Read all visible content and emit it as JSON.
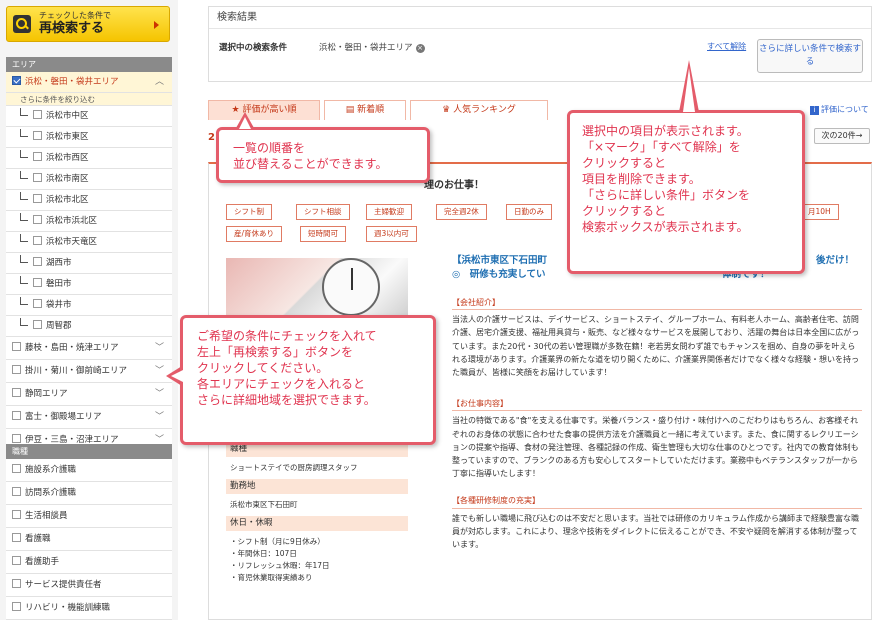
{
  "research_button": {
    "small": "チェックした条件で",
    "big": "再検索する"
  },
  "sidebar": {
    "area_header": "エリア",
    "selected_area": "浜松・磐田・袋井エリア",
    "narrow_hint": "さらに条件を絞り込む",
    "sub_areas": [
      "浜松市中区",
      "浜松市東区",
      "浜松市西区",
      "浜松市南区",
      "浜松市北区",
      "浜松市浜北区",
      "浜松市天竜区",
      "湖西市",
      "磐田市",
      "袋井市",
      "周智郡"
    ],
    "other_areas": [
      "藤枝・島田・焼津エリア",
      "掛川・菊川・御前崎エリア",
      "静岡エリア",
      "富士・御殿場エリア",
      "伊豆・三島・沼津エリア"
    ],
    "job_header": "職種",
    "jobs": [
      "施設系介護職",
      "訪問系介護職",
      "生活相談員",
      "看護職",
      "看護助手",
      "サービス提供責任者",
      "リハビリ・機能訓練職"
    ]
  },
  "results": {
    "header": "検索結果",
    "condition_label": "選択中の検索条件",
    "condition_value": "浜松・磐田・袋井エリア",
    "clear_all": "すべて解除",
    "more_conditions": "さらに詳しい条件で検索する"
  },
  "tabs": [
    "評価が高い順",
    "新着順",
    "人気ランキング"
  ],
  "rating_link": "評価について",
  "count_prefix": "2",
  "next_button": "次の20件→",
  "card": {
    "title_fragment": "理のお仕事！",
    "tags": [
      "シフト制",
      "シフト相談",
      "主婦歓迎",
      "完全週2休",
      "日勤のみ",
      "月10H",
      "産/育休あり",
      "短時間可",
      "週3以内可"
    ],
    "head_lines": [
      "【浜松市東区下石田町",
      "後だけ！",
      "◎　研修も充実してい",
      "体制です！"
    ],
    "sections": [
      {
        "title": "【会社紹介】",
        "body": "当法人の介護サービスは、デイサービス、ショートステイ、グループホーム、有料老人ホーム、高齢者住宅、訪問介護、居宅介護支援、福祉用具貸与・販売、など様々なサービスを展開しており、活躍の舞台は日本全国に広がっています。また20代・30代の若い管理職が多数在籍！老若男女問わず誰でもチャンスを掴め、自身の夢を叶えられる環境があります。介護業界の新たな道を切り開くために、介護業界関係者だけでなく様々な経験・想いを持った職員が、皆様に笑顔をお届けしています！"
      },
      {
        "title": "【お仕事内容】",
        "body": "当社の特徴である\"食\"を支える仕事です。栄養バランス・盛り付け・味付けへのこだわりはもちろん、お客様それぞれのお身体の状態に合わせた食事の提供方法を介護職員と一緒に考えています。また、食に関するレクリエーションの提案や指導、食材の発注管理、各種記録の作成、衛生管理も大切な仕事のひとつです。社内での教育体制も整っていますので、ブランクのある方も安心してスタートしていただけます。業務中もベテランスタッフが一から丁寧に指導いたします！"
      },
      {
        "title": "【各種研修制度の充実】",
        "body": "誰でも新しい職場に飛び込むのは不安だと思います。当社では研修のカリキュラム作成から講師まで経験豊富な職員が対応します。これにより、理念や技術をダイレクトに伝えることができ、不安や疑問を解消する体制が整っています。"
      }
    ],
    "info": [
      {
        "label": "職種",
        "value": "ショートステイでの厨房調理スタッフ"
      },
      {
        "label": "勤務地",
        "value": "浜松市東区下石田町"
      },
      {
        "label": "休日・休暇",
        "value": "・シフト制（月に9日休み）\n・年間休日：107日\n・リフレッシュ休暇：年17日\n・育児休業取得実績あり"
      }
    ]
  },
  "callouts": {
    "sort": [
      "一覧の順番を",
      "並び替えることができます。"
    ],
    "selection": [
      "選択中の項目が表示されます。",
      "「×マーク」「すべて解除」を",
      "クリックすると",
      "項目を削除できます。",
      "「さらに詳しい条件」ボタンを",
      "クリックすると",
      "検索ボックスが表示されます。"
    ],
    "check": [
      "ご希望の条件にチェックを入れて",
      "左上「再検索する」ボタンを",
      "クリックしてください。",
      "各エリアにチェックを入れると",
      "さらに詳細地域を選択できます。"
    ]
  }
}
